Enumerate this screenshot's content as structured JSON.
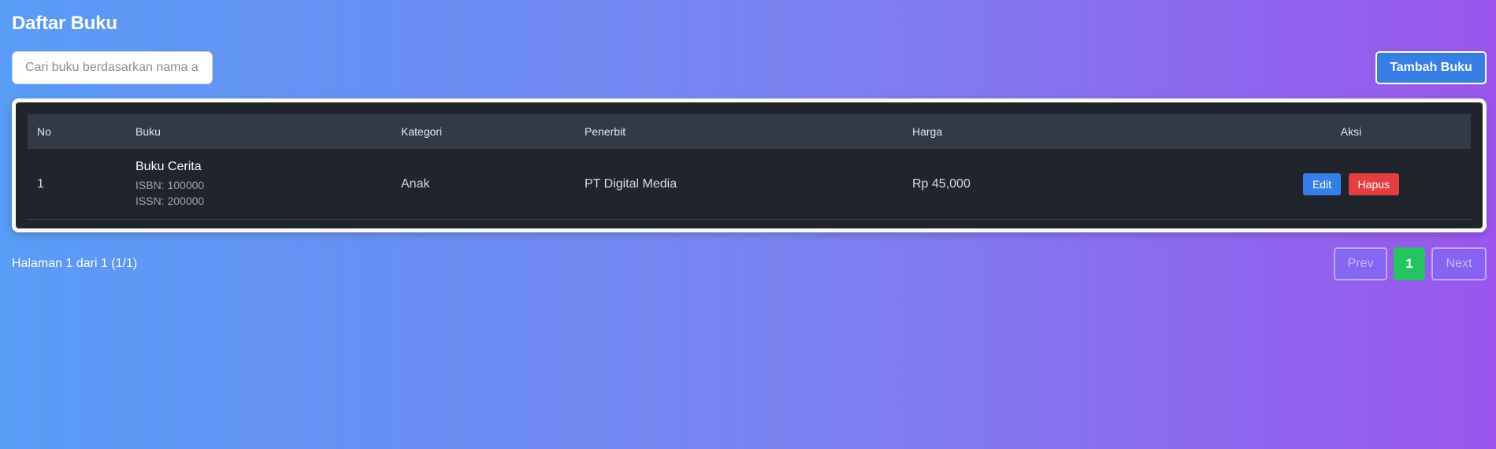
{
  "page": {
    "title": "Daftar Buku"
  },
  "search": {
    "placeholder": "Cari buku berdasarkan nama atau ISBN",
    "value": ""
  },
  "toolbar": {
    "add_label": "Tambah Buku"
  },
  "table": {
    "columns": [
      "No",
      "Buku",
      "Kategori",
      "Penerbit",
      "Harga",
      "Aksi"
    ],
    "rows": [
      {
        "no": "1",
        "title": "Buku Cerita",
        "isbn": "ISBN: 100000",
        "issn": "ISSN: 200000",
        "kategori": "Anak",
        "penerbit": "PT Digital Media",
        "harga": "Rp 45,000",
        "edit_label": "Edit",
        "delete_label": "Hapus"
      }
    ]
  },
  "pagination": {
    "info": "Halaman 1 dari 1 (1/1)",
    "prev_label": "Prev",
    "current": "1",
    "next_label": "Next"
  },
  "colors": {
    "background_left": "#589cf6",
    "background_right": "#9b55ee",
    "table_bg": "#1f242d",
    "header_bg": "#323a47",
    "primary": "#3580e8",
    "danger": "#e53e3e",
    "success": "#22c55e"
  }
}
